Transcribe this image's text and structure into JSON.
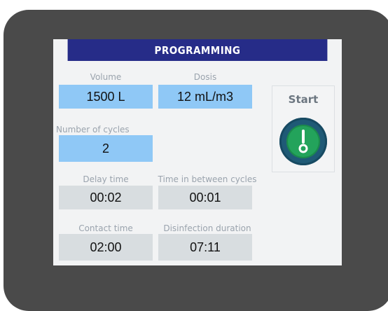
{
  "screen": {
    "title": "PROGRAMMING"
  },
  "fields": {
    "volume": {
      "label": "Volume",
      "value": "1500 L"
    },
    "dosis": {
      "label": "Dosis",
      "value": "12 mL/m3"
    },
    "cycles": {
      "label": "Number of cycles",
      "value": "2"
    },
    "delay_time": {
      "label": "Delay time",
      "value": "00:02"
    },
    "time_between_cycles": {
      "label": "Time in between cycles",
      "value": "00:01"
    },
    "contact_time": {
      "label": "Contact time",
      "value": "02:00"
    },
    "disinfection_duration": {
      "label": "Disinfection duration",
      "value": "07:11"
    }
  },
  "start": {
    "label": "Start",
    "icon": "power-toggle-icon"
  },
  "colors": {
    "title_bar": "#262c88",
    "input_blue": "#8fc8f6",
    "readonly_gray": "#d8dde0",
    "start_green": "#23a35b",
    "device_body": "#4a4a4a"
  }
}
